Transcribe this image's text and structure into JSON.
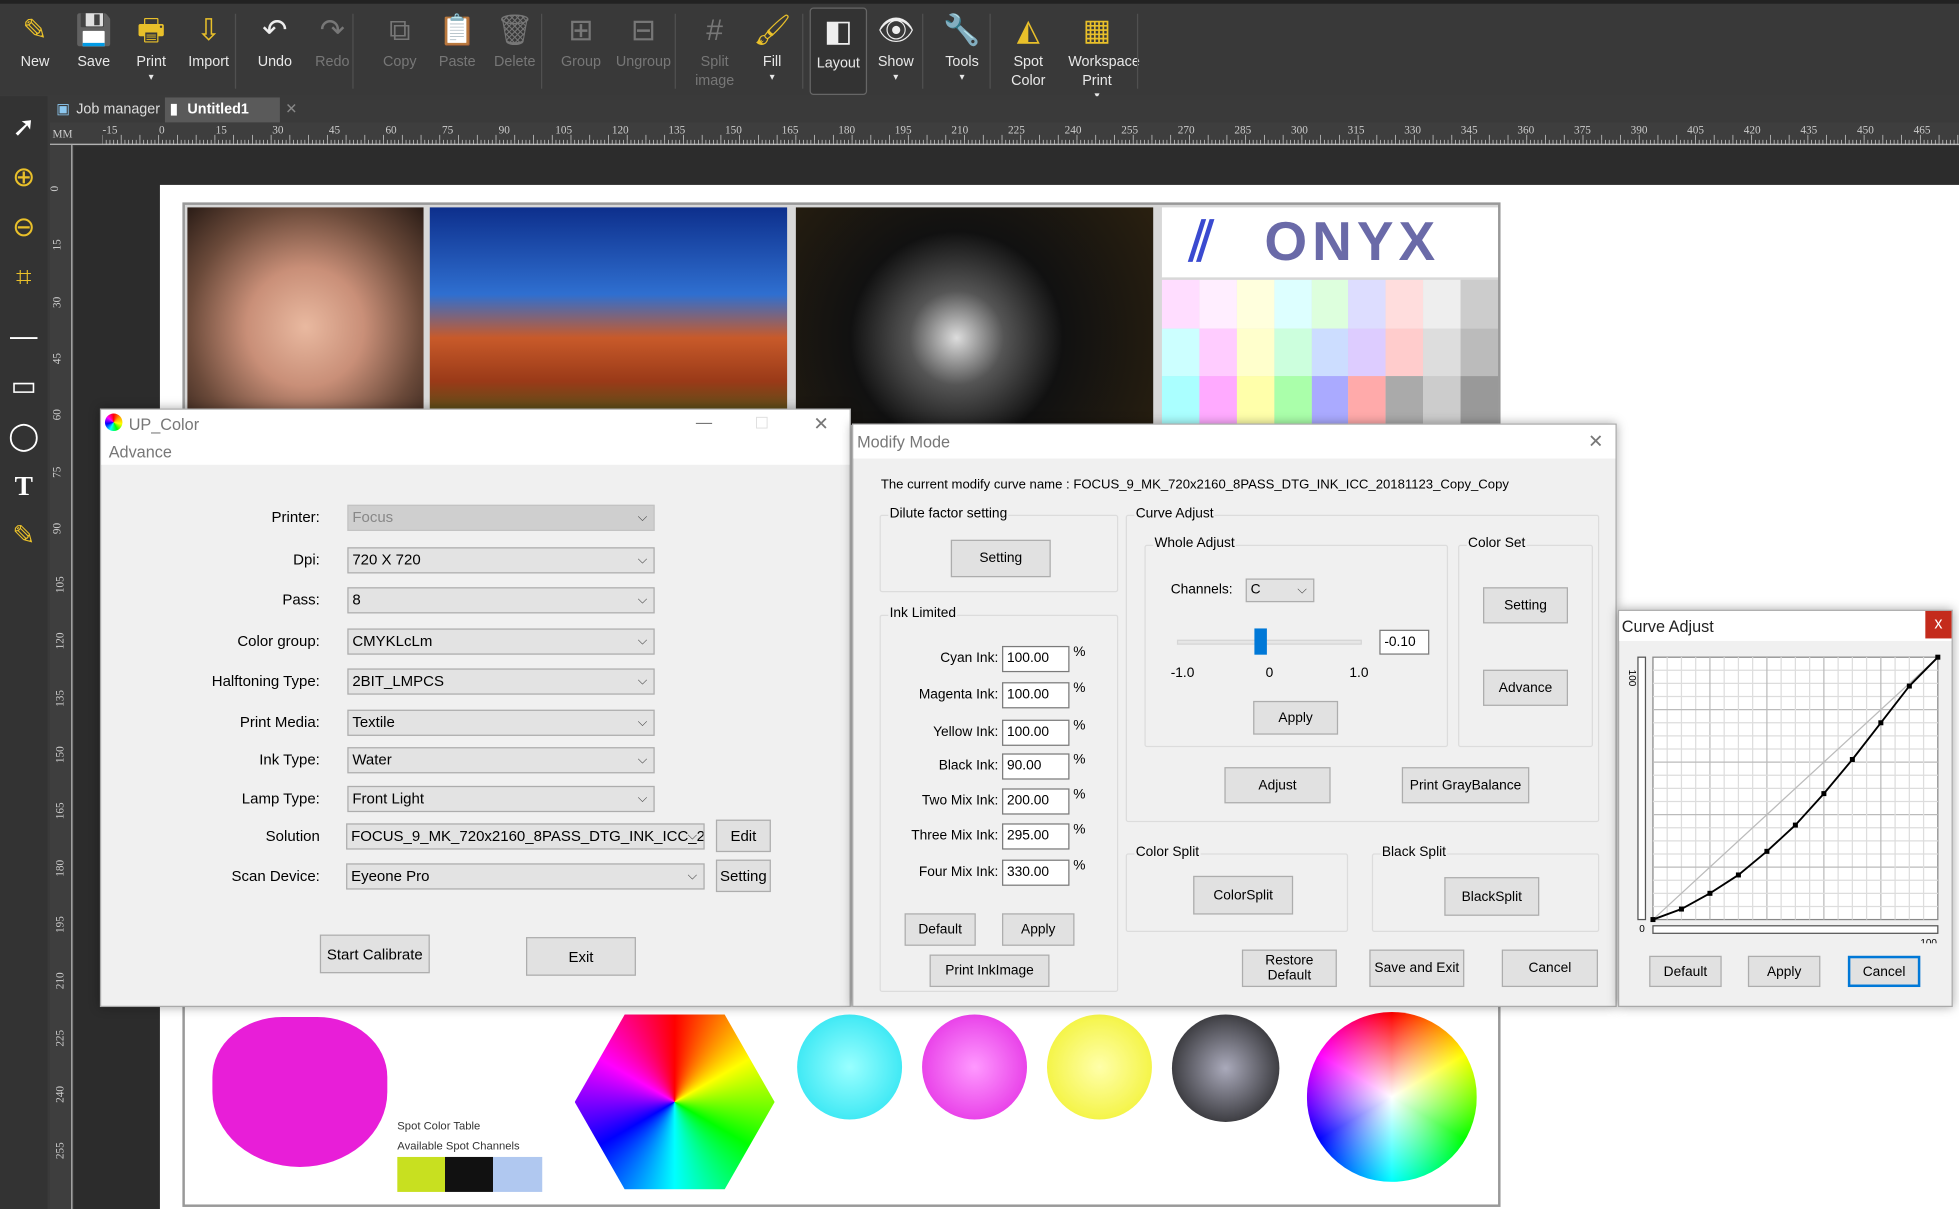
{
  "toolbar": {
    "items": [
      {
        "label": "New",
        "icon": "new-icon",
        "enabled": true
      },
      {
        "label": "Save",
        "icon": "save-icon",
        "enabled": true
      },
      {
        "label": "Print",
        "icon": "print-icon",
        "enabled": true,
        "dropdown": true
      },
      {
        "label": "Import",
        "icon": "import-icon",
        "enabled": true
      },
      {
        "label": "Undo",
        "icon": "undo-icon",
        "enabled": true
      },
      {
        "label": "Redo",
        "icon": "redo-icon",
        "enabled": false
      },
      {
        "label": "Copy",
        "icon": "copy-icon",
        "enabled": false
      },
      {
        "label": "Paste",
        "icon": "paste-icon",
        "enabled": false
      },
      {
        "label": "Delete",
        "icon": "delete-icon",
        "enabled": false
      },
      {
        "label": "Group",
        "icon": "group-icon",
        "enabled": false
      },
      {
        "label": "Ungroup",
        "icon": "ungroup-icon",
        "enabled": false
      },
      {
        "label": "Split image",
        "icon": "split-icon",
        "enabled": false
      },
      {
        "label": "Fill",
        "icon": "fill-icon",
        "enabled": true,
        "dropdown": true
      },
      {
        "label": "Layout",
        "icon": "layout-icon",
        "enabled": true,
        "selected": true
      },
      {
        "label": "Show",
        "icon": "eye-icon",
        "enabled": true,
        "dropdown": true
      },
      {
        "label": "Tools",
        "icon": "wrench-icon",
        "enabled": true,
        "dropdown": true
      },
      {
        "label": "Spot Color",
        "icon": "spot-color-icon",
        "enabled": true
      },
      {
        "label": "Workspace Print",
        "icon": "workspace-print-icon",
        "enabled": true,
        "dropdown": true
      }
    ]
  },
  "tabs": [
    {
      "label": "Job manager",
      "active": false
    },
    {
      "label": "Untitled1",
      "active": true
    }
  ],
  "ruler": {
    "unit": "MM",
    "h_labels": [
      "-15",
      "0",
      "15",
      "30",
      "45",
      "60",
      "75",
      "90",
      "105",
      "120",
      "135",
      "150",
      "165",
      "180",
      "195",
      "210",
      "225",
      "240",
      "255",
      "270",
      "285",
      "300",
      "315",
      "330",
      "345",
      "360",
      "375",
      "390",
      "405",
      "420",
      "435",
      "450",
      "465"
    ],
    "v_labels": [
      "0",
      "15",
      "30",
      "45",
      "60",
      "75",
      "90",
      "105",
      "120",
      "135",
      "150",
      "165",
      "180",
      "195",
      "210",
      "225",
      "240",
      "255"
    ]
  },
  "preview": {
    "logo": "ONYX",
    "spot_table": "Spot Color Table",
    "spot_channels": "Available Spot Channels"
  },
  "up_color": {
    "title": "UP_Color",
    "menu": "Advance",
    "fields": [
      {
        "label": "Printer:",
        "value": "Focus",
        "disabled": true
      },
      {
        "label": "Dpi:",
        "value": "720 X 720"
      },
      {
        "label": "Pass:",
        "value": "8"
      },
      {
        "label": "Color group:",
        "value": "CMYKLcLm"
      },
      {
        "label": "Halftoning Type:",
        "value": "2BIT_LMPCS"
      },
      {
        "label": "Print Media:",
        "value": "Textile"
      },
      {
        "label": "Ink Type:",
        "value": "Water"
      },
      {
        "label": "Lamp Type:",
        "value": "Front Light"
      },
      {
        "label": "Solution",
        "value": "FOCUS_9_MK_720x2160_8PASS_DTG_INK_ICC_2"
      },
      {
        "label": "Scan Device:",
        "value": "Eyeone Pro"
      }
    ],
    "edit": "Edit",
    "setting": "Setting",
    "start": "Start Calibrate",
    "exit": "Exit"
  },
  "modify": {
    "title": "Modify Mode",
    "curve_name_label": "The current modify curve name :",
    "curve_name": "FOCUS_9_MK_720x2160_8PASS_DTG_INK_ICC_20181123_Copy_Copy",
    "dilute": {
      "title": "Dilute factor setting",
      "button": "Setting"
    },
    "ink": {
      "title": "Ink Limited",
      "rows": [
        {
          "label": "Cyan Ink:",
          "value": "100.00"
        },
        {
          "label": "Magenta Ink:",
          "value": "100.00"
        },
        {
          "label": "Yellow Ink:",
          "value": "100.00"
        },
        {
          "label": "Black Ink:",
          "value": "90.00"
        },
        {
          "label": "Two Mix Ink:",
          "value": "200.00"
        },
        {
          "label": "Three Mix Ink:",
          "value": "295.00"
        },
        {
          "label": "Four Mix Ink:",
          "value": "330.00"
        }
      ],
      "unit": "%",
      "default": "Default",
      "apply": "Apply",
      "print": "Print InkImage"
    },
    "curve": {
      "title": "Curve Adjust",
      "whole": "Whole Adjust",
      "channels_label": "Channels:",
      "channel": "C",
      "slider_value": "-0.10",
      "slider_fraction": 0.45,
      "min": "-1.0",
      "mid": "0",
      "max": "1.0",
      "apply": "Apply",
      "color_set": "Color Set",
      "setting": "Setting",
      "advance": "Advance",
      "adjust": "Adjust",
      "gray": "Print GrayBalance"
    },
    "color_split": {
      "title": "Color Split",
      "button": "ColorSplit"
    },
    "black_split": {
      "title": "Black Split",
      "button": "BlackSplit"
    },
    "restore": "Restore Default",
    "save_exit": "Save and Exit",
    "cancel": "Cancel"
  },
  "curve_adjust": {
    "title": "Curve Adjust",
    "close": "x",
    "y_max": "100",
    "origin": "0",
    "x_max": "100",
    "default": "Default",
    "apply": "Apply",
    "cancel": "Cancel",
    "points": [
      [
        0,
        0
      ],
      [
        10,
        4
      ],
      [
        20,
        10
      ],
      [
        30,
        17
      ],
      [
        40,
        26
      ],
      [
        50,
        36
      ],
      [
        60,
        48
      ],
      [
        70,
        61
      ],
      [
        80,
        75
      ],
      [
        90,
        89
      ],
      [
        100,
        100
      ]
    ]
  },
  "colors": {
    "accent": "#0078d7",
    "close_red": "#c42b1c",
    "toolbar": "#393939",
    "icon_yellow": "#e9c02a"
  }
}
